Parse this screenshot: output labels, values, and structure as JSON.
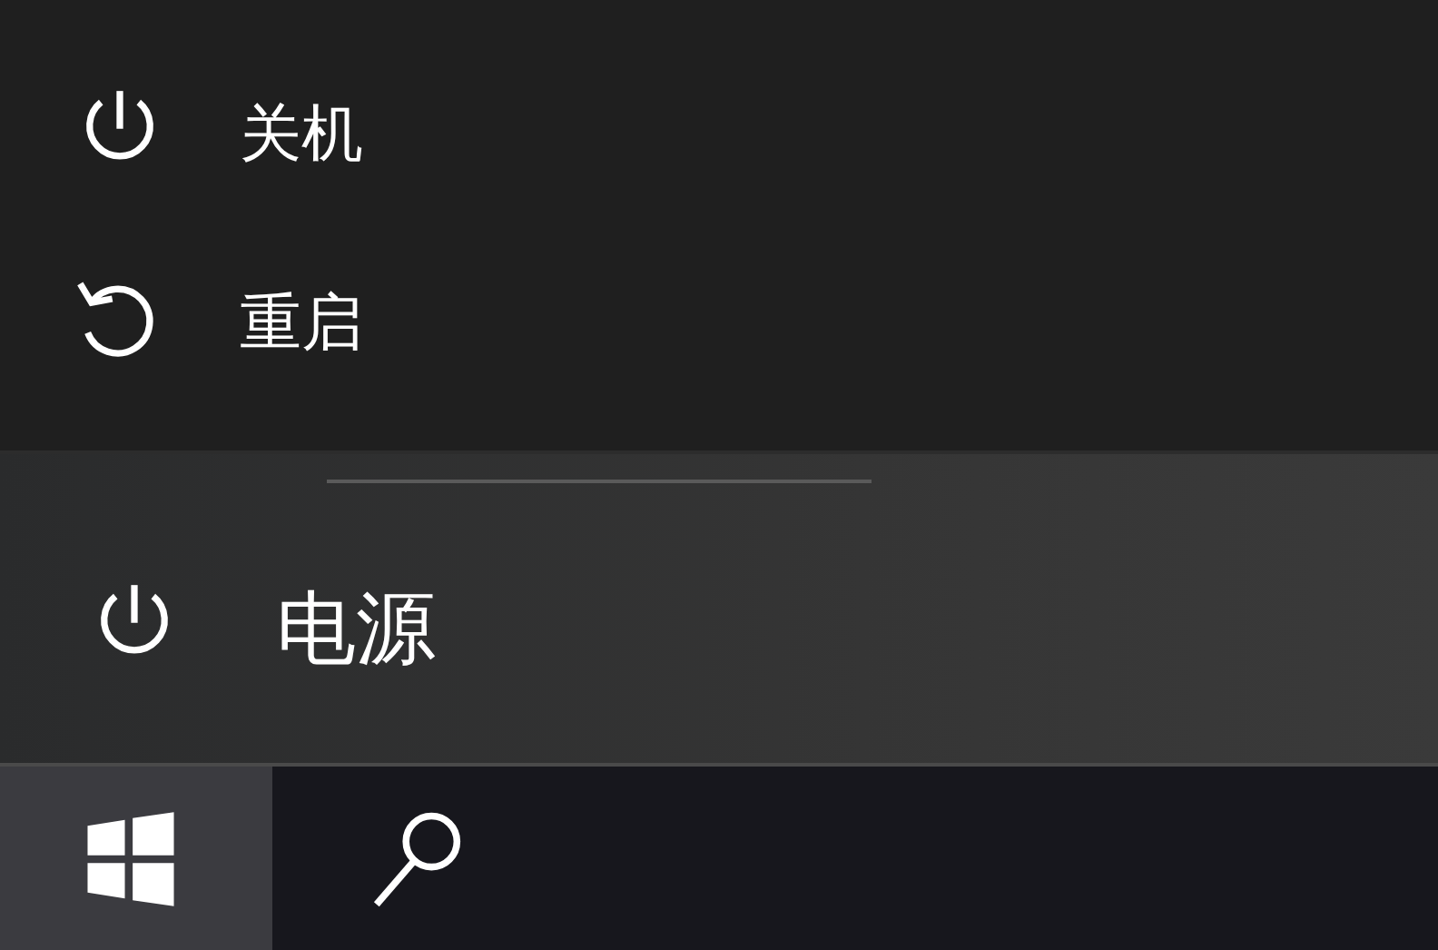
{
  "power_menu": {
    "items": [
      {
        "kind": "shutdown",
        "label": "关机"
      },
      {
        "kind": "restart",
        "label": "重启"
      }
    ]
  },
  "start_menu": {
    "power_button": {
      "label": "电源"
    }
  },
  "taskbar": {
    "buttons": [
      {
        "kind": "start",
        "selected": true
      },
      {
        "kind": "search",
        "selected": false
      }
    ]
  }
}
